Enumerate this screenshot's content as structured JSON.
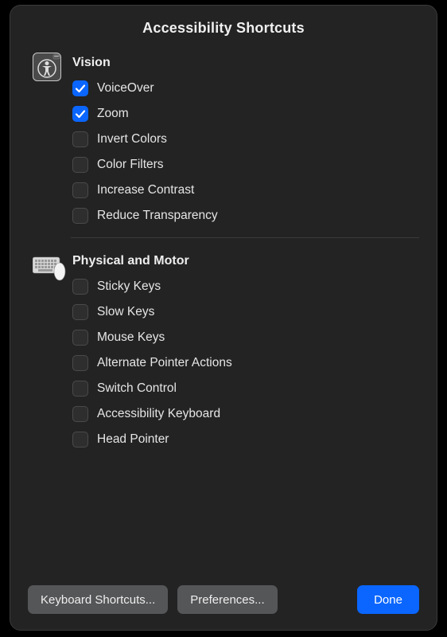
{
  "title": "Accessibility Shortcuts",
  "sections": [
    {
      "title": "Vision",
      "icon": "accessibility-icon",
      "options": [
        {
          "label": "VoiceOver",
          "checked": true
        },
        {
          "label": "Zoom",
          "checked": true
        },
        {
          "label": "Invert Colors",
          "checked": false
        },
        {
          "label": "Color Filters",
          "checked": false
        },
        {
          "label": "Increase Contrast",
          "checked": false
        },
        {
          "label": "Reduce Transparency",
          "checked": false
        }
      ]
    },
    {
      "title": "Physical and Motor",
      "icon": "keyboard-mouse-icon",
      "options": [
        {
          "label": "Sticky Keys",
          "checked": false
        },
        {
          "label": "Slow Keys",
          "checked": false
        },
        {
          "label": "Mouse Keys",
          "checked": false
        },
        {
          "label": "Alternate Pointer Actions",
          "checked": false
        },
        {
          "label": "Switch Control",
          "checked": false
        },
        {
          "label": "Accessibility Keyboard",
          "checked": false
        },
        {
          "label": "Head Pointer",
          "checked": false
        }
      ]
    }
  ],
  "buttons": {
    "keyboard_shortcuts": "Keyboard Shortcuts...",
    "preferences": "Preferences...",
    "done": "Done"
  }
}
